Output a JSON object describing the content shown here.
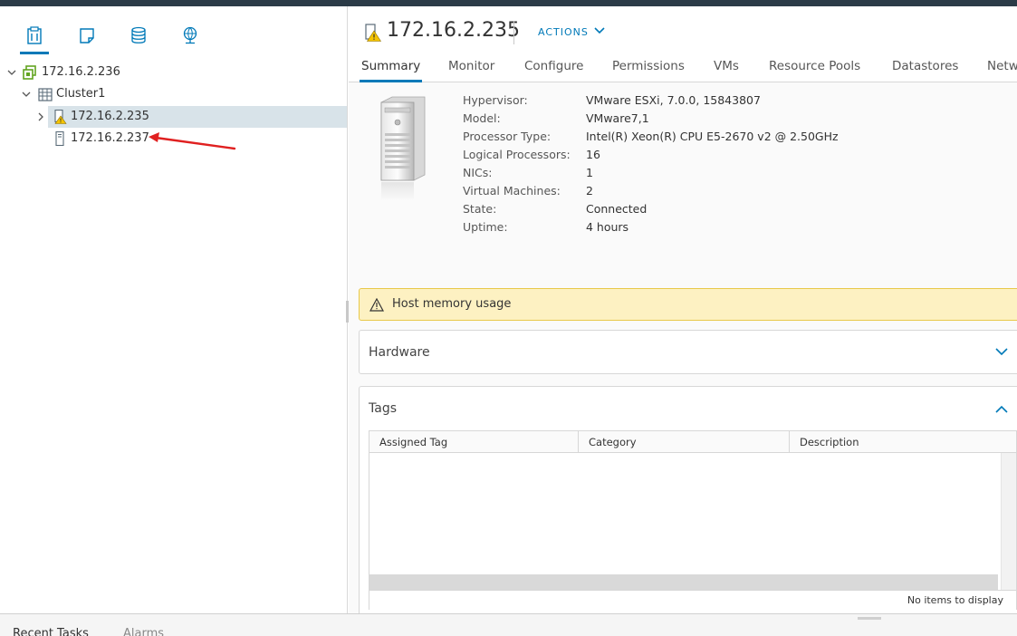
{
  "colors": {
    "accent": "#0079b8",
    "host_green": "#62a420",
    "warning": "#f5c400",
    "annotation_arrow": "#e02020"
  },
  "navigator": {
    "icons": [
      {
        "name": "hosts-and-clusters-icon",
        "active": true
      },
      {
        "name": "vms-and-templates-icon",
        "active": false
      },
      {
        "name": "storage-icon",
        "active": false
      },
      {
        "name": "networking-icon",
        "active": false
      }
    ],
    "tree": [
      {
        "label": "172.16.2.236",
        "icon": "datacenter-icon",
        "expanded": true
      },
      {
        "label": "Cluster1",
        "icon": "cluster-icon",
        "expanded": true
      },
      {
        "label": "172.16.2.235",
        "icon": "host-warning-icon",
        "expanded": false,
        "selected": true
      },
      {
        "label": "172.16.2.237",
        "icon": "host-icon"
      }
    ]
  },
  "header": {
    "title": "172.16.2.235",
    "actions_label": "ACTIONS",
    "tabs": [
      "Summary",
      "Monitor",
      "Configure",
      "Permissions",
      "VMs",
      "Resource Pools",
      "Datastores",
      "Netw"
    ],
    "active_tab": "Summary"
  },
  "summary": {
    "properties": [
      {
        "key": "Hypervisor:",
        "value": "VMware ESXi, 7.0.0, 15843807"
      },
      {
        "key": "Model:",
        "value": "VMware7,1"
      },
      {
        "key": "Processor Type:",
        "value": "Intel(R) Xeon(R) CPU E5-2670 v2 @ 2.50GHz"
      },
      {
        "key": "Logical Processors:",
        "value": "16"
      },
      {
        "key": "NICs:",
        "value": "1"
      },
      {
        "key": "Virtual Machines:",
        "value": "2"
      },
      {
        "key": "State:",
        "value": "Connected"
      },
      {
        "key": "Uptime:",
        "value": "4 hours"
      }
    ]
  },
  "alert": {
    "text": "Host memory usage"
  },
  "hardware": {
    "title": "Hardware"
  },
  "tags": {
    "title": "Tags",
    "columns": [
      "Assigned Tag",
      "Category",
      "Description"
    ],
    "empty_text": "No items to display"
  },
  "bottom_tabs": [
    "Recent Tasks",
    "Alarms"
  ]
}
